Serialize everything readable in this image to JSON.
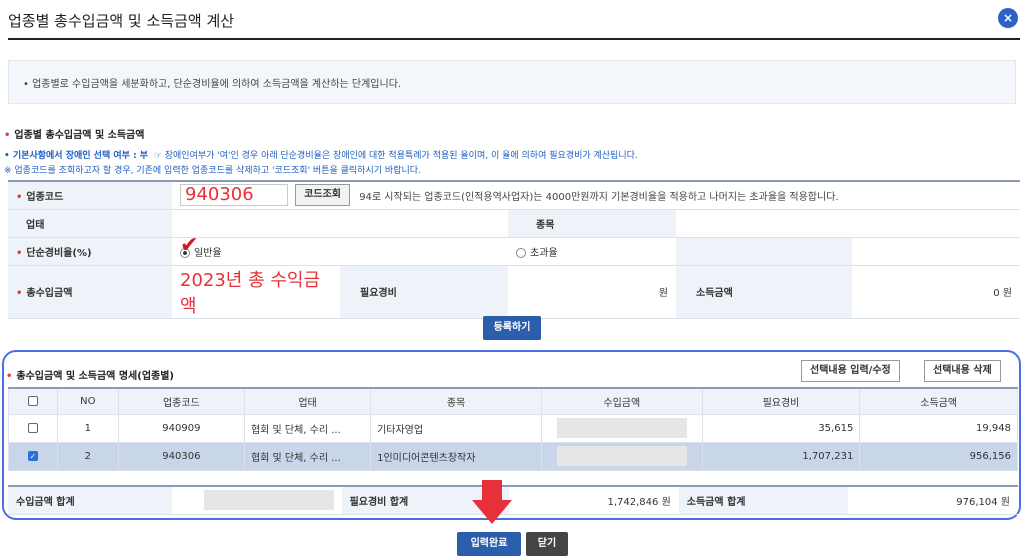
{
  "dialog": {
    "title": "업종별 총수입금액 및 소득금액 계산",
    "close_icon": "×"
  },
  "notice": "• 업종별로 수입금액을 세분화하고, 단순경비율에 의하여 소득금액을 계산하는 단계입니다.",
  "section1": {
    "title": "업종별 총수입금액 및 소득금액",
    "note_label": "• 기본사항에서 장애인 선택 여부 : 부",
    "note_text": "☞ 장애인여부가 '여'인 경우 아래 단순경비율은 장애인에 대한 적용특례가 적용된 율이며, 이 율에 의하여 필요경비가 계산됩니다.",
    "note2": "※ 업종코드를 조회하고자 할 경우, 기존에 입력한 업종코드를 삭제하고 '코드조회' 버튼을 클릭하시기 바랍니다."
  },
  "form": {
    "code_label": "업종코드",
    "code_value": "940306",
    "code_btn": "코드조회",
    "code_desc": "94로 시작되는 업종코드(인적용역사업자)는 4000만원까지 기본경비율을 적용하고 나머지는 초과율을 적용합니다.",
    "type_label": "업태",
    "item_label": "종목",
    "rate_label": "단순경비율(%)",
    "rate_opt1": "일반율",
    "rate_opt2": "초과율",
    "revenue_label": "총수입금액",
    "revenue_value": "2023년 총 수익금액",
    "expense_label": "필요경비",
    "expense_value": "원",
    "income_label": "소득금액",
    "income_value": "0 원"
  },
  "register_btn": "등록하기",
  "list": {
    "title": "총수입금액 및 소득금액 명세(업종별)",
    "btn_edit": "선택내용 입력/수정",
    "btn_delete": "선택내용 삭제",
    "headers": [
      "NO",
      "업종코드",
      "업태",
      "종목",
      "수입금액",
      "필요경비",
      "소득금액"
    ],
    "rows": [
      {
        "no": "1",
        "code": "940909",
        "type": "협회 및 단체, 수리 ...",
        "item": "기타자영업",
        "expense": "35,615",
        "income": "19,948"
      },
      {
        "no": "2",
        "code": "940306",
        "type": "협회 및 단체, 수리 ...",
        "item": "1인미디어콘텐츠창작자",
        "expense": "1,707,231",
        "income": "956,156"
      }
    ]
  },
  "summary": {
    "revenue_label": "수입금액 합계",
    "expense_label": "필요경비 합계",
    "expense_value": "1,742,846 원",
    "income_label": "소득금액 합계",
    "income_value": "976,104 원"
  },
  "footer": {
    "done_btn": "입력완료",
    "close_btn": "닫기"
  }
}
